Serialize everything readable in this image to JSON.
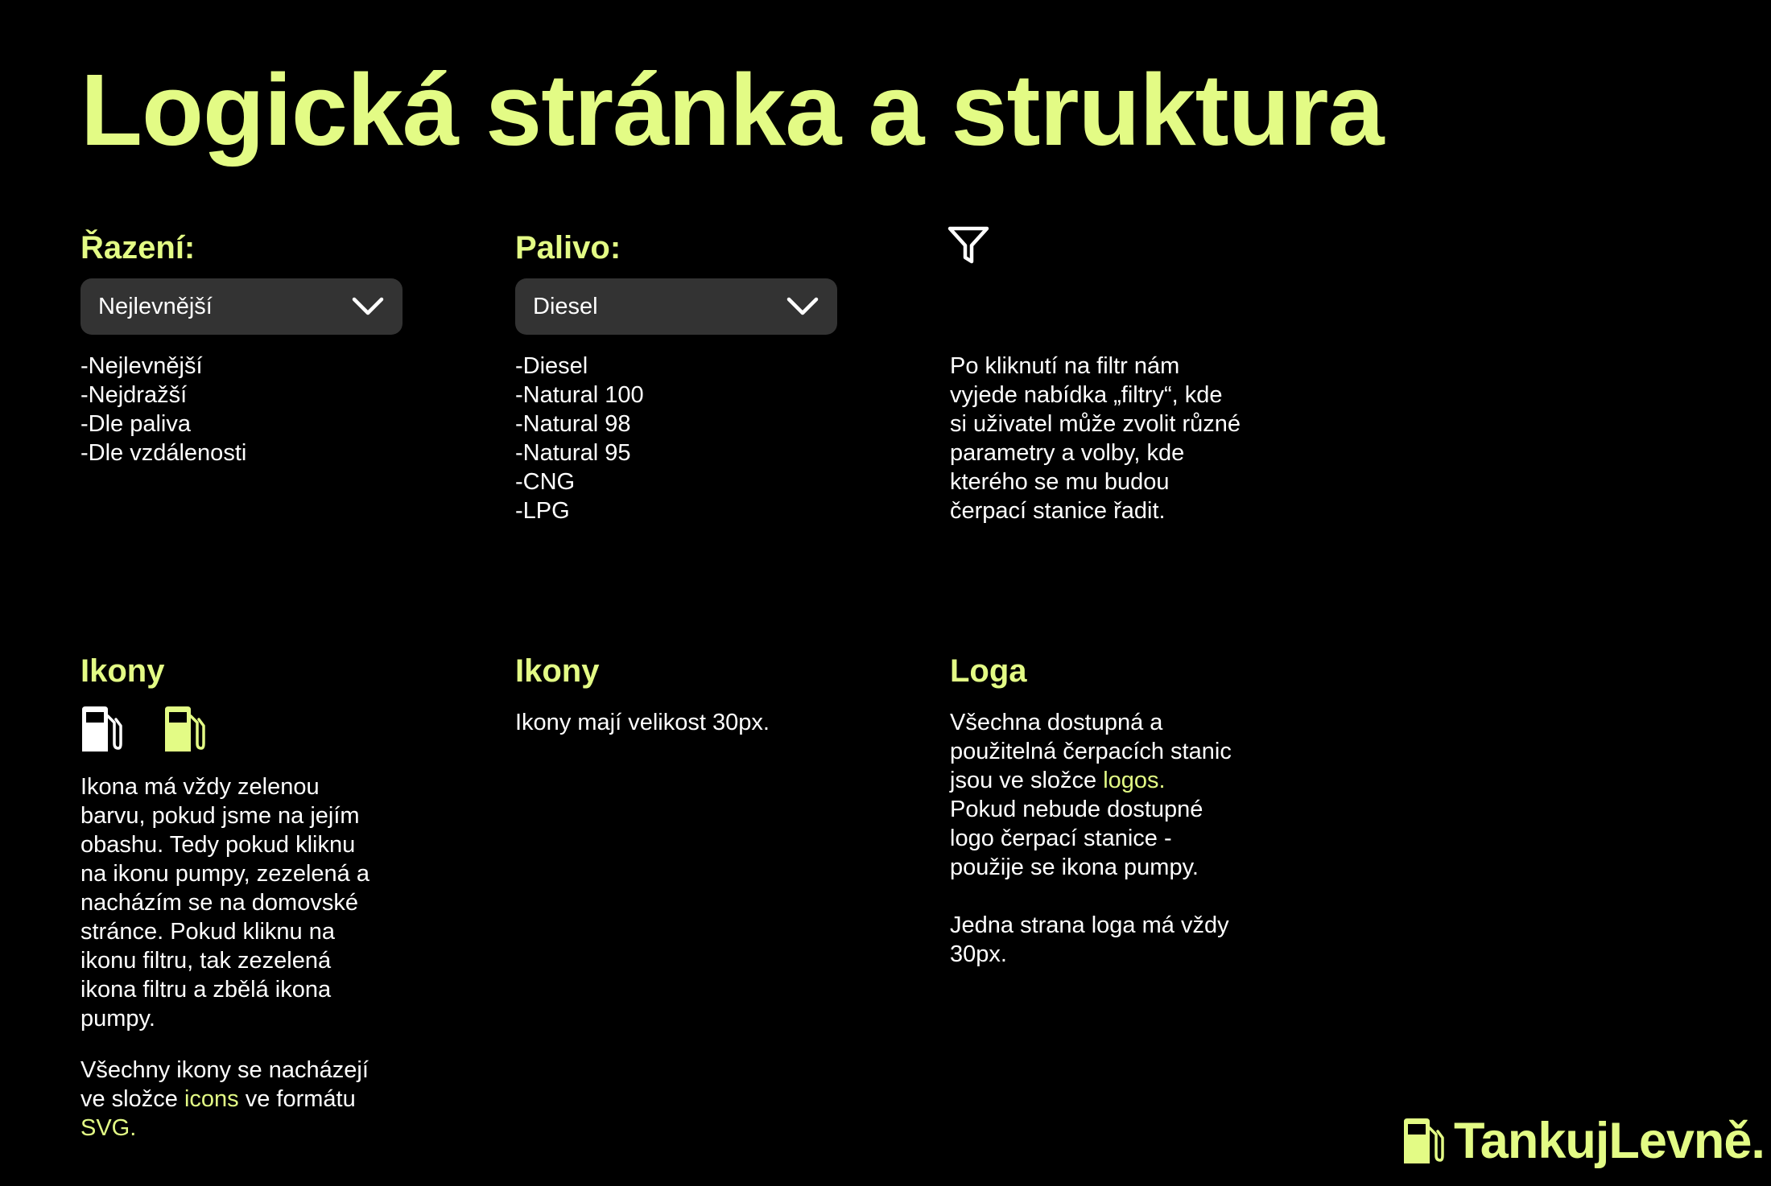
{
  "title": "Logická stránka a struktura",
  "colors": {
    "accent": "#e3fb85",
    "background": "#000000",
    "select_bg": "#333333",
    "text": "#ffffff"
  },
  "sorting": {
    "heading": "Řazení:",
    "selected": "Nejlevnější",
    "options": [
      "-Nejlevnější",
      "-Nejdražší",
      "-Dle paliva",
      "-Dle vzdálenosti"
    ]
  },
  "fuel": {
    "heading": "Palivo:",
    "selected": "Diesel",
    "options": [
      "-Diesel",
      "-Natural 100",
      "-Natural 98",
      "-Natural 95",
      "-CNG",
      "-LPG"
    ]
  },
  "filter": {
    "icon": "filter-icon",
    "description": [
      "Po kliknutí na filtr nám",
      "vyjede nabídka „filtry“, kde",
      "si uživatel může zvolit různé",
      "parametry a volby, kde",
      "kterého se mu budou",
      "čerpací stanice řadit."
    ]
  },
  "icons_section": {
    "heading": "Ikony",
    "icons": [
      "fuel-pump-icon-white",
      "fuel-pump-icon-green"
    ],
    "description": [
      "Ikona má vždy zelenou",
      "barvu, pokud jsme na jejím",
      "obashu. Tedy pokud kliknu",
      "na ikonu pumpy, zezelená a",
      "nacházím se na domovské",
      "stránce. Pokud kliknu na",
      "ikonu filtru, tak zezelená",
      "ikona filtru a zbělá ikona",
      "pumpy."
    ],
    "folder_line1": "Všechny ikony se nacházejí",
    "folder_line2_pre": "ve složce ",
    "folder_name": "icons",
    "folder_line2_post": " ve formátu",
    "format": "SVG."
  },
  "icons_size": {
    "heading": "Ikony",
    "text": "Ikony mají velikost 30px."
  },
  "logos": {
    "heading": "Loga",
    "line1": "Všechna dostupná a",
    "line2": "použitelná čerpacích stanic",
    "line3_pre": "jsou ve složce ",
    "folder": "logos.",
    "line4": "Pokud nebude dostupné",
    "line5": "logo čerpací stanice -",
    "line6": "použije se ikona pumpy.",
    "size_line1": "Jedna strana loga má vždy",
    "size_line2": "30px."
  },
  "brand": {
    "name": "TankujLevně.",
    "icon": "fuel-pump-icon"
  }
}
